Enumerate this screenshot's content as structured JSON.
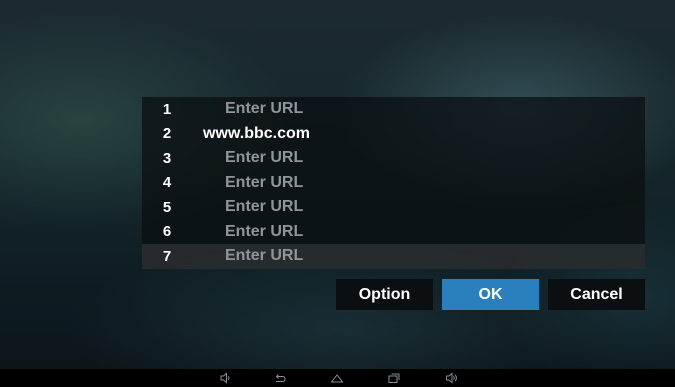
{
  "url_list": {
    "rows": [
      {
        "number": "1",
        "value": "Enter URL"
      },
      {
        "number": "2",
        "value": "www.bbc.com"
      },
      {
        "number": "3",
        "value": "Enter URL"
      },
      {
        "number": "4",
        "value": "Enter URL"
      },
      {
        "number": "5",
        "value": "Enter URL"
      },
      {
        "number": "6",
        "value": "Enter URL"
      },
      {
        "number": "7",
        "value": "Enter URL"
      }
    ],
    "selected_row": "7"
  },
  "buttons": {
    "option_label": "Option",
    "ok_label": "OK",
    "cancel_label": "Cancel"
  },
  "navbar": {
    "icons": [
      "volume-down-icon",
      "back-icon",
      "home-icon",
      "recent-apps-icon",
      "volume-up-icon"
    ]
  },
  "colors": {
    "accent": "#2a7fbf",
    "placeholder_text": "#8f9599",
    "filled_text": "#ffffff"
  }
}
